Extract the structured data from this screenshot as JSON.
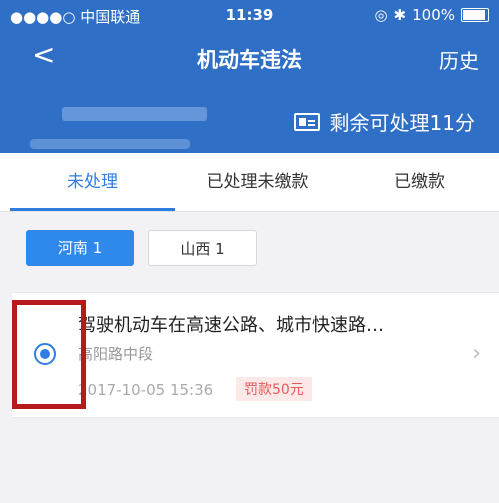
{
  "status_bar": {
    "carrier": "●●●●○ 中国联通",
    "time": "11:39",
    "battery": "100%",
    "battery_level": 100,
    "icons": [
      "wifi-icon",
      "location-icon",
      "bluetooth-icon",
      "battery-icon"
    ]
  },
  "nav": {
    "back_glyph": "<",
    "title": "机动车违法",
    "history_label": "历史"
  },
  "banner": {
    "remain_text": "剩余可处理11分",
    "icon": "id-card-icon"
  },
  "tabs": [
    {
      "label": "未处理",
      "active": true
    },
    {
      "label": "已处理未缴款",
      "active": false
    },
    {
      "label": "已缴款",
      "active": false
    }
  ],
  "region_chips": [
    {
      "label": "河南 1",
      "active": true
    },
    {
      "label": "山西 1",
      "active": false
    }
  ],
  "violations": [
    {
      "title": "驾驶机动车在高速公路、城市快速路…",
      "location": "高阳路中段",
      "time": "2017-10-05 15:36",
      "fine": "罚款50元",
      "selected": true
    }
  ],
  "colors": {
    "primary": "#2f6fc6",
    "accent": "#2f7de1",
    "fine_text": "#e85a5a",
    "highlight": "#b51b1b"
  }
}
